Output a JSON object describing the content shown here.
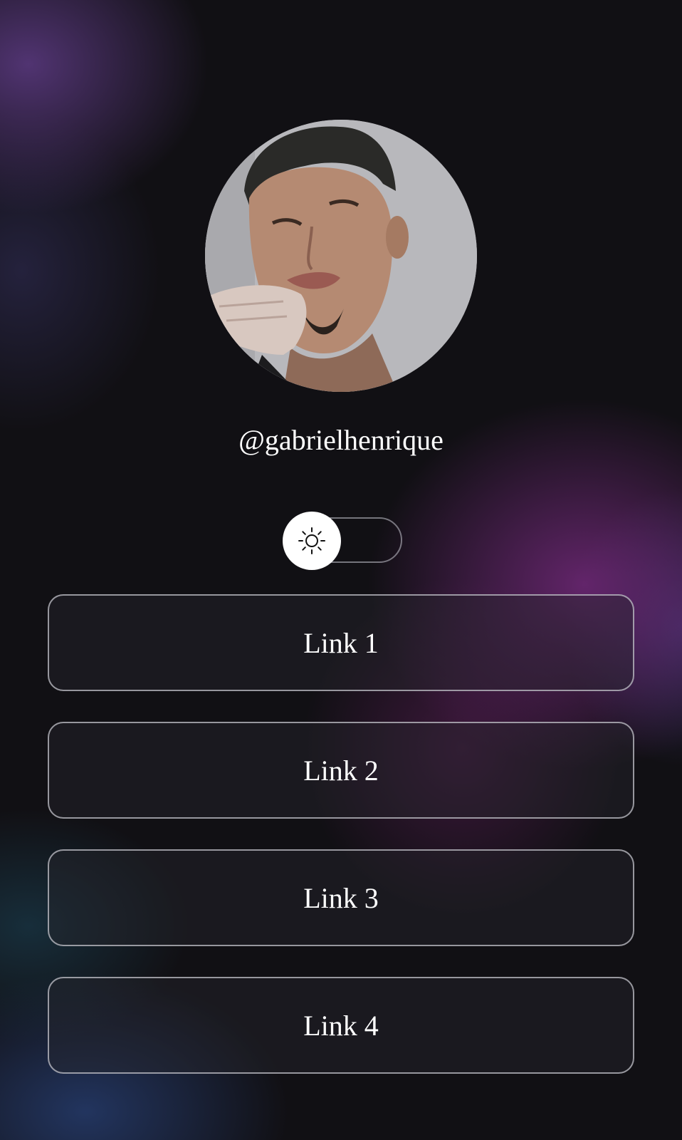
{
  "profile": {
    "username": "@gabrielhenrique",
    "avatar_icon": "profile-photo"
  },
  "theme_toggle": {
    "icon": "sun-icon",
    "state": "light"
  },
  "links": [
    {
      "label": "Link 1"
    },
    {
      "label": "Link 2"
    },
    {
      "label": "Link 3"
    },
    {
      "label": "Link 4"
    }
  ],
  "colors": {
    "background": "#111014",
    "accent_purple": "#702878",
    "accent_blue": "#284178",
    "text": "#ffffff",
    "border": "#cdcdd4"
  }
}
